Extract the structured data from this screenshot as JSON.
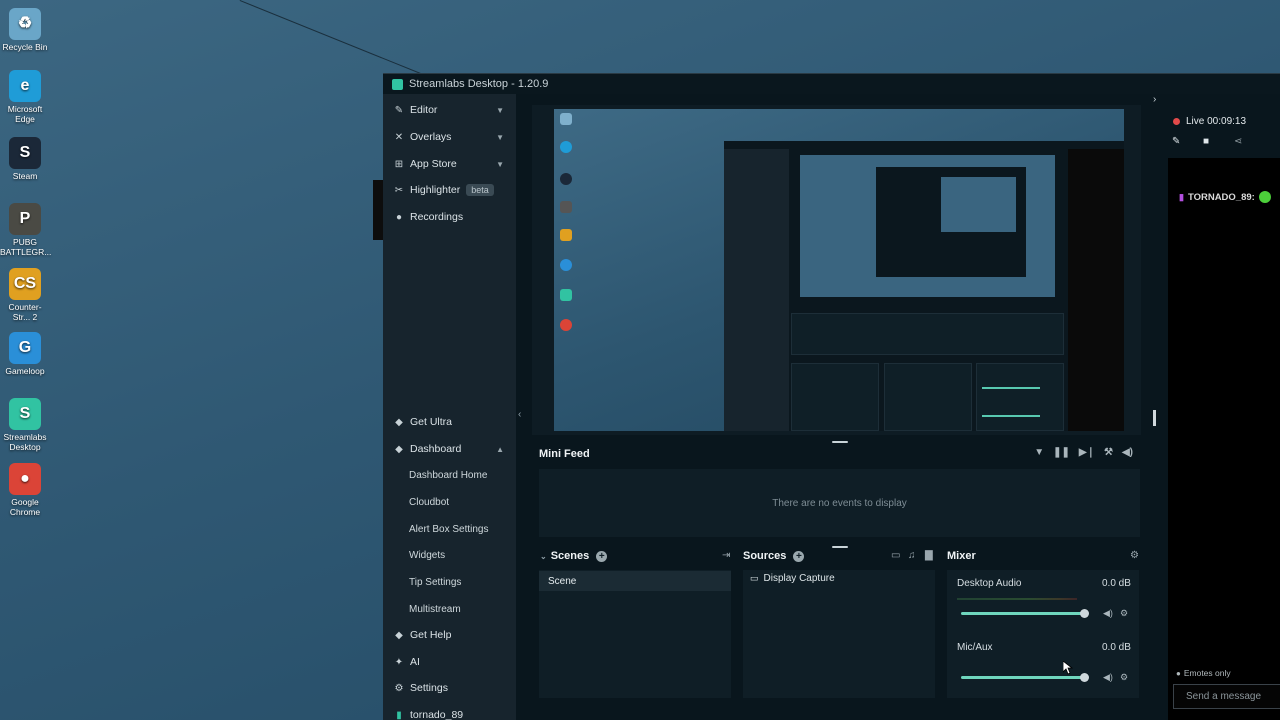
{
  "desktop": {
    "icons": [
      {
        "label": "Recycle Bin",
        "icon": "recycle-bin-icon",
        "color": "#6aa6c8",
        "glyph": "♻"
      },
      {
        "label": "Microsoft Edge",
        "icon": "edge-icon",
        "color": "#1f9cd7",
        "glyph": "e"
      },
      {
        "label": "Steam",
        "icon": "steam-icon",
        "color": "#1b2838",
        "glyph": "S"
      },
      {
        "label": "PUBG BATTLEGR...",
        "icon": "pubg-icon",
        "color": "#4a4a44",
        "glyph": "P"
      },
      {
        "label": "Counter-Str... 2",
        "icon": "counter-strike-icon",
        "color": "#e0a020",
        "glyph": "CS"
      },
      {
        "label": "Gameloop",
        "icon": "gameloop-icon",
        "color": "#2a8fd8",
        "glyph": "G"
      },
      {
        "label": "Streamlabs Desktop",
        "icon": "streamlabs-icon",
        "color": "#31c3a2",
        "glyph": "S"
      },
      {
        "label": "Google Chrome",
        "icon": "chrome-icon",
        "color": "#db4437",
        "glyph": "●"
      }
    ]
  },
  "window": {
    "title": "Streamlabs Desktop - 1.20.9"
  },
  "sidebar": {
    "top_items": [
      {
        "label": "Editor",
        "icon": "editor-icon",
        "glyph": "✎",
        "chevron": "▼"
      },
      {
        "label": "Overlays",
        "icon": "overlays-icon",
        "glyph": "✕",
        "chevron": "▼"
      },
      {
        "label": "App Store",
        "icon": "app-store-icon",
        "glyph": "⊞",
        "chevron": "▼"
      },
      {
        "label": "Highlighter",
        "icon": "highlighter-icon",
        "glyph": "✂",
        "badge": "beta"
      },
      {
        "label": "Recordings",
        "icon": "recordings-icon",
        "glyph": "●"
      }
    ],
    "bottom_items": [
      {
        "label": "Get Ultra",
        "icon": "ultra-icon",
        "glyph": "◆"
      },
      {
        "label": "Dashboard",
        "icon": "dashboard-icon",
        "glyph": "◆",
        "chevron": "▲"
      }
    ],
    "dashboard_sub": [
      "Dashboard Home",
      "Cloudbot",
      "Alert Box Settings",
      "Widgets",
      "Tip Settings",
      "Multistream"
    ],
    "footer_items": [
      {
        "label": "Get Help",
        "icon": "help-icon",
        "glyph": "◆"
      },
      {
        "label": "AI",
        "icon": "ai-icon",
        "glyph": "✦"
      },
      {
        "label": "Settings",
        "icon": "settings-icon",
        "glyph": "⚙"
      }
    ],
    "user": "tornado_89"
  },
  "minifeed": {
    "title": "Mini Feed",
    "empty_text": "There are no events to display"
  },
  "scenes": {
    "title": "Scenes",
    "items": [
      "Scene"
    ]
  },
  "sources": {
    "title": "Sources",
    "items": [
      "Display Capture"
    ]
  },
  "mixer": {
    "title": "Mixer",
    "channels": [
      {
        "name": "Desktop Audio",
        "db": "0.0 dB",
        "level": 1.0
      },
      {
        "name": "Mic/Aux",
        "db": "0.0 dB",
        "level": 1.0
      }
    ]
  },
  "chat": {
    "live_status": "Live 00:09:13",
    "username": "TORNADO_89:",
    "emotes_only": "Emotes only",
    "input_placeholder": "Send a message"
  },
  "colors": {
    "accent": "#31c3a2",
    "live": "#e24a4a"
  }
}
